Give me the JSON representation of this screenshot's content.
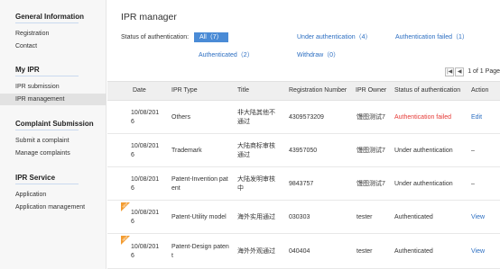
{
  "sidebar": {
    "sections": [
      {
        "title": "General Information",
        "items": [
          "Registration",
          "Contact"
        ]
      },
      {
        "title": "My IPR",
        "items": [
          "IPR submission",
          "IPR management"
        ]
      },
      {
        "title": "Complaint Submission",
        "items": [
          "Submit a complaint",
          "Manage complaints"
        ]
      },
      {
        "title": "IPR Service",
        "items": [
          "Application",
          "Application management"
        ]
      }
    ],
    "active_item": "IPR management"
  },
  "main": {
    "title": "IPR manager",
    "filter_label": "Status of authentication:",
    "filters": {
      "all": "All（7）",
      "under_auth": "Under authentication（4）",
      "auth_failed": "Authentication failed（1）",
      "authenticated": "Authenticated（2）",
      "withdraw": "Withdraw（0）"
    },
    "pager": {
      "first": "|◀",
      "prev": "◀",
      "text": "1 of 1 Page"
    },
    "table": {
      "headers": {
        "date": "Date",
        "type": "IPR Type",
        "title": "Title",
        "reg": "Registration Number",
        "owner": "IPR Owner",
        "status": "Status of authentication",
        "action": "Action"
      },
      "rows": [
        {
          "date_l1": "10/08/201",
          "date_l2": "6",
          "type_l1": "Others",
          "type_l2": "",
          "title_l1": "非大陆其他不",
          "title_l2": "通过",
          "reg": "4309573209",
          "owner": "馒图测试7",
          "status": "Authentication failed",
          "action": "Edit",
          "badge": ""
        },
        {
          "date_l1": "10/08/201",
          "date_l2": "6",
          "type_l1": "Trademark",
          "type_l2": "",
          "title_l1": "大陆商标审核",
          "title_l2": "通过",
          "reg": "43957050",
          "owner": "馒图测试7",
          "status": "Under authentication",
          "action": "–",
          "badge": ""
        },
        {
          "date_l1": "10/08/201",
          "date_l2": "6",
          "type_l1": "Patent-Invention pat",
          "type_l2": "ent",
          "title_l1": "大陆发明审核",
          "title_l2": "中",
          "reg": "9843757",
          "owner": "馒图测试7",
          "status": "Under authentication",
          "action": "–",
          "badge": ""
        },
        {
          "date_l1": "10/08/201",
          "date_l2": "6",
          "type_l1": "Patent-Utility model",
          "type_l2": "",
          "title_l1": "海外实用通过",
          "title_l2": "",
          "reg": "030303",
          "owner": "tester",
          "status": "Authenticated",
          "action": "View",
          "badge": "NEW"
        },
        {
          "date_l1": "10/08/201",
          "date_l2": "6",
          "type_l1": "Patent-Design paten",
          "type_l2": "t",
          "title_l1": "海外外观通过",
          "title_l2": "",
          "reg": "040404",
          "owner": "tester",
          "status": "Authenticated",
          "action": "View",
          "badge": "NEW"
        }
      ]
    }
  },
  "colors": {
    "link": "#2a6dc1",
    "error": "#e53935",
    "active_filter": "#4a8bd6",
    "badge": "#f39c31"
  }
}
